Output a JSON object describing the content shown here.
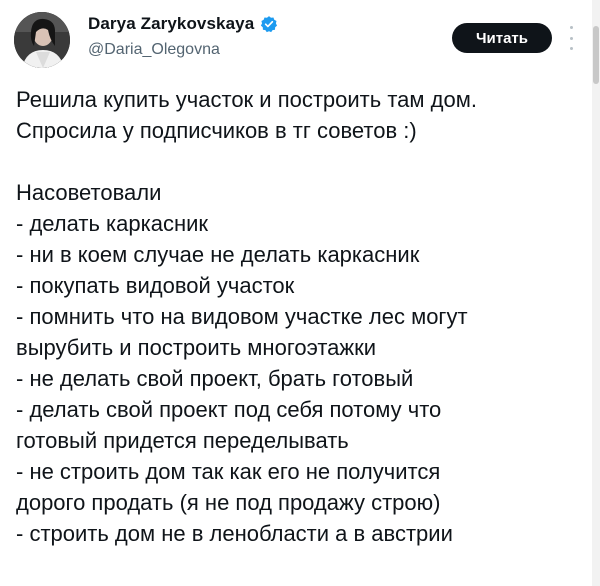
{
  "author": {
    "display_name": "Darya Zarykovskaya",
    "handle": "@Daria_Olegovna",
    "verified": true,
    "avatar_icon": "profile-photo"
  },
  "actions": {
    "follow_label": "Читать",
    "more_icon": "vertical-ellipsis-icon"
  },
  "colors": {
    "text": "#0f1419",
    "secondary": "#536471",
    "verified_badge": "#1d9bf0",
    "button_bg": "#0f1419"
  },
  "tweet": {
    "intro": [
      "Решила купить участок и построить там дом.",
      "Спросила у подписчиков в тг советов :)"
    ],
    "heading": "Насоветовали",
    "lines": [
      "- делать каркасник",
      "- ни в коем случае не делать каркасник",
      "- покупать видовой участок",
      "- помнить что на видовом участке лес могут",
      "вырубить и построить многоэтажки",
      "- не делать свой проект, брать готовый",
      "- делать свой проект под себя потому что",
      "готовый придется переделывать",
      "- не строить дом так как его не получится",
      "дорого продать (я не под продажу строю)",
      "- строить дом не в ленобласти а в австрии"
    ]
  }
}
